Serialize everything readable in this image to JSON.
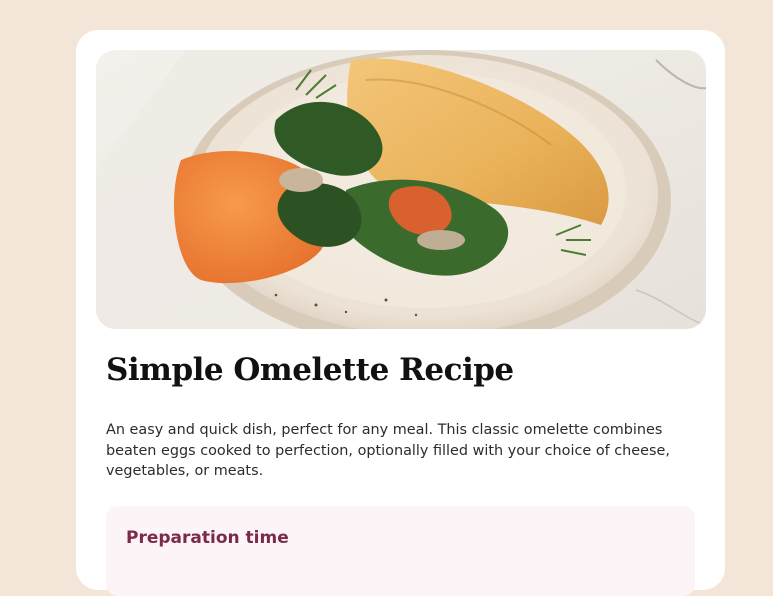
{
  "recipe": {
    "image_alt": "Omelette on a plate with spinach, herbs, and carrot spread",
    "title": "Simple Omelette Recipe",
    "description": "An easy and quick dish, perfect for any meal. This classic omelette combines beaten eggs cooked to perfection, optionally filled with your choice of cheese, vegetables, or meats.",
    "preparation": {
      "heading": "Preparation time"
    }
  },
  "colors": {
    "page_background": "#f3e5d8",
    "card_background": "#ffffff",
    "title": "#111111",
    "body_text": "#2c2c2c",
    "prep_background": "#fdf4f8",
    "prep_heading": "#7a2a4b"
  }
}
